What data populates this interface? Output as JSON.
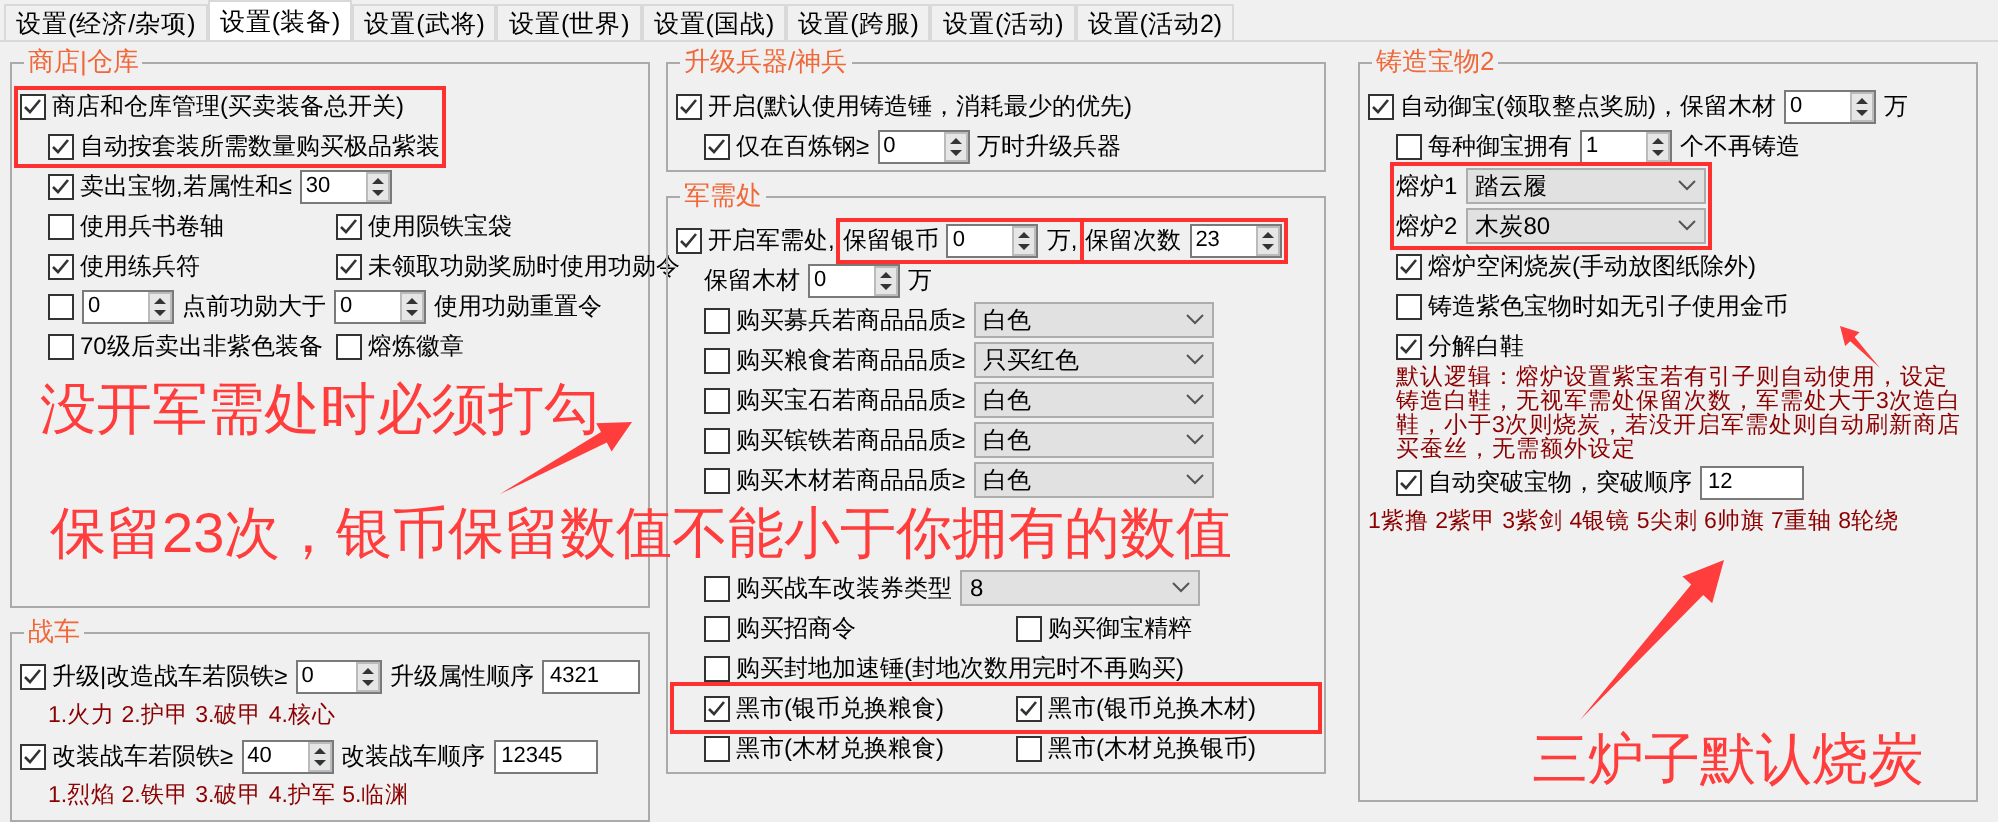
{
  "tabs": [
    {
      "label": "设置(经济/杂项)",
      "selected": false
    },
    {
      "label": "设置(装备)",
      "selected": true
    },
    {
      "label": "设置(武将)",
      "selected": false
    },
    {
      "label": "设置(世界)",
      "selected": false
    },
    {
      "label": "设置(国战)",
      "selected": false
    },
    {
      "label": "设置(跨服)",
      "selected": false
    },
    {
      "label": "设置(活动)",
      "selected": false
    },
    {
      "label": "设置(活动2)",
      "selected": false
    }
  ],
  "columns": [
    {
      "groups": [
        {
          "title": "商店|仓库",
          "rows": [
            {
              "indent": false,
              "items": [
                {
                  "kind": "check",
                  "label": "商店和仓库管理(买卖装备总开关)",
                  "checked": true
                }
              ]
            },
            {
              "indent": true,
              "items": [
                {
                  "kind": "check",
                  "label": "自动按套装所需数量购买极品紫装",
                  "checked": true
                }
              ]
            },
            {
              "indent": true,
              "items": [
                {
                  "kind": "check",
                  "label": "卖出宝物,若属性和≤",
                  "checked": true
                },
                {
                  "kind": "spin",
                  "value": "30"
                }
              ]
            },
            {
              "indent": true,
              "items": [
                {
                  "kind": "check",
                  "label": "使用兵书卷轴",
                  "checked": false
                },
                {
                  "kind": "check",
                  "label": "使用陨铁宝袋",
                  "checked": true
                }
              ]
            },
            {
              "indent": true,
              "items": [
                {
                  "kind": "check",
                  "label": "使用练兵符",
                  "checked": true
                },
                {
                  "kind": "check",
                  "label": "未领取功勋奖励时使用功勋令",
                  "checked": true
                }
              ]
            },
            {
              "indent": true,
              "items": [
                {
                  "kind": "check",
                  "checked": false
                },
                {
                  "kind": "spin",
                  "value": "0"
                },
                {
                  "kind": "label",
                  "text": "点前功勋大于"
                },
                {
                  "kind": "spin",
                  "value": "0"
                },
                {
                  "kind": "label",
                  "text": "使用功勋重置令"
                }
              ]
            },
            {
              "indent": true,
              "items": [
                {
                  "kind": "check",
                  "label": "70级后卖出非紫色装备",
                  "checked": false
                },
                {
                  "kind": "check",
                  "label": "熔炼徽章",
                  "checked": false
                }
              ]
            }
          ]
        },
        {
          "title": "战车",
          "rows": [
            {
              "indent": false,
              "items": [
                {
                  "kind": "check",
                  "label": "升级|改造战车若陨铁≥",
                  "checked": true
                },
                {
                  "kind": "spin",
                  "value": "0"
                },
                {
                  "kind": "label",
                  "text": "升级属性顺序"
                },
                {
                  "kind": "input",
                  "value": "4321"
                }
              ]
            },
            {
              "indent": true,
              "items": [
                {
                  "kind": "note",
                  "text": "1.火力 2.护甲 3.破甲 4.核心"
                }
              ]
            },
            {
              "indent": false,
              "items": [
                {
                  "kind": "check",
                  "label": "改装战车若陨铁≥",
                  "checked": true
                },
                {
                  "kind": "spin",
                  "value": "40"
                },
                {
                  "kind": "label",
                  "text": "改装战车顺序"
                },
                {
                  "kind": "input",
                  "value": "12345"
                }
              ]
            },
            {
              "indent": true,
              "items": [
                {
                  "kind": "note",
                  "text": "1.烈焰 2.铁甲 3.破甲 4.护军 5.临渊"
                }
              ]
            }
          ]
        }
      ]
    },
    {
      "groups": [
        {
          "title": "升级兵器/神兵",
          "rows": [
            {
              "indent": false,
              "items": [
                {
                  "kind": "check",
                  "label": "开启(默认使用铸造锤，消耗最少的优先)",
                  "checked": true
                }
              ]
            },
            {
              "indent": true,
              "items": [
                {
                  "kind": "check",
                  "label": "仅在百炼钢≥",
                  "checked": true
                },
                {
                  "kind": "spin",
                  "value": "0"
                },
                {
                  "kind": "label",
                  "text": "万时升级兵器"
                }
              ]
            }
          ]
        },
        {
          "title": "军需处",
          "rows": [
            {
              "indent": false,
              "items": [
                {
                  "kind": "check",
                  "label": "开启军需处,",
                  "checked": true
                },
                {
                  "kind": "label",
                  "text": "保留银币"
                },
                {
                  "kind": "spin",
                  "value": "0"
                },
                {
                  "kind": "label",
                  "text": "万,"
                },
                {
                  "kind": "label",
                  "text": "保留次数"
                },
                {
                  "kind": "spin",
                  "value": "23"
                }
              ]
            },
            {
              "indent": true,
              "items": [
                {
                  "kind": "label",
                  "text": "保留木材"
                },
                {
                  "kind": "spin",
                  "value": "0"
                },
                {
                  "kind": "label",
                  "text": "万"
                }
              ]
            },
            {
              "indent": true,
              "items": [
                {
                  "kind": "check",
                  "label": "购买募兵若商品品质≥",
                  "checked": false
                },
                {
                  "kind": "select",
                  "value": "白色"
                }
              ]
            },
            {
              "indent": true,
              "items": [
                {
                  "kind": "check",
                  "label": "购买粮食若商品品质≥",
                  "checked": false
                },
                {
                  "kind": "select",
                  "value": "只买红色"
                }
              ]
            },
            {
              "indent": true,
              "items": [
                {
                  "kind": "check",
                  "label": "购买宝石若商品品质≥",
                  "checked": false
                },
                {
                  "kind": "select",
                  "value": "白色"
                }
              ]
            },
            {
              "indent": true,
              "items": [
                {
                  "kind": "check",
                  "label": "购买镔铁若商品品质≥",
                  "checked": false
                },
                {
                  "kind": "select",
                  "value": "白色"
                }
              ]
            },
            {
              "indent": true,
              "items": [
                {
                  "kind": "check",
                  "label": "购买木材若商品品质≥",
                  "checked": false
                },
                {
                  "kind": "select",
                  "value": "白色"
                }
              ]
            },
            {
              "indent": true,
              "items": [
                {
                  "kind": "check",
                  "label": "购买战车改装券类型",
                  "checked": false
                },
                {
                  "kind": "select",
                  "value": "8"
                }
              ]
            },
            {
              "indent": true,
              "items": [
                {
                  "kind": "check",
                  "label": "购买招商令",
                  "checked": false
                },
                {
                  "kind": "check",
                  "label": "购买御宝精粹",
                  "checked": false
                }
              ]
            },
            {
              "indent": true,
              "items": [
                {
                  "kind": "check",
                  "label": "购买封地加速锤(封地次数用完时不再购买)",
                  "checked": false
                }
              ]
            },
            {
              "indent": true,
              "items": [
                {
                  "kind": "check",
                  "label": "黑市(银币兑换粮食)",
                  "checked": true
                },
                {
                  "kind": "check",
                  "label": "黑市(银币兑换木材)",
                  "checked": true
                }
              ]
            },
            {
              "indent": true,
              "items": [
                {
                  "kind": "check",
                  "label": "黑市(木材兑换粮食)",
                  "checked": false
                },
                {
                  "kind": "check",
                  "label": "黑市(木材兑换银币)",
                  "checked": false
                }
              ]
            }
          ]
        }
      ]
    },
    {
      "groups": [
        {
          "title": "铸造宝物2",
          "rows": [
            {
              "indent": false,
              "items": [
                {
                  "kind": "check",
                  "label": "自动御宝(领取整点奖励)，保留木材",
                  "checked": true
                },
                {
                  "kind": "spin",
                  "value": "0"
                },
                {
                  "kind": "label",
                  "text": "万"
                }
              ]
            },
            {
              "indent": true,
              "items": [
                {
                  "kind": "check",
                  "label": "每种御宝拥有",
                  "checked": false
                },
                {
                  "kind": "spin",
                  "value": "1"
                },
                {
                  "kind": "label",
                  "text": "个不再铸造"
                }
              ]
            },
            {
              "indent": true,
              "items": [
                {
                  "kind": "label",
                  "text": "熔炉1"
                },
                {
                  "kind": "select",
                  "value": "踏云履"
                }
              ]
            },
            {
              "indent": true,
              "items": [
                {
                  "kind": "label",
                  "text": "熔炉2"
                },
                {
                  "kind": "select",
                  "value": "木炭80"
                }
              ]
            },
            {
              "indent": true,
              "items": [
                {
                  "kind": "check",
                  "label": "熔炉空闲烧炭(手动放图纸除外)",
                  "checked": true
                }
              ]
            },
            {
              "indent": true,
              "items": [
                {
                  "kind": "check",
                  "label": "铸造紫色宝物时如无引子使用金币",
                  "checked": false
                }
              ]
            },
            {
              "indent": true,
              "items": [
                {
                  "kind": "check",
                  "label": "分解白鞋",
                  "checked": true
                }
              ]
            },
            {
              "indent": true,
              "items": [
                {
                  "kind": "note",
                  "text": "默认逻辑：熔炉设置紫宝若有引子则自动使用，设定铸造白鞋，无视军需处保留次数，军需处大于3次造白鞋，小于3次则烧炭，若没开启军需处则自动刷新商店买蚕丝，无需额外设定"
                }
              ]
            },
            {
              "indent": true,
              "items": [
                {
                  "kind": "check",
                  "label": "自动突破宝物，突破顺序",
                  "checked": true
                },
                {
                  "kind": "input",
                  "value": "12"
                }
              ]
            },
            {
              "indent": false,
              "items": [
                {
                  "kind": "note",
                  "text": "1紫撸 2紫甲 3紫剑 4银镜 5尖刺 6帅旗 7重轴 8轮绕"
                }
              ]
            }
          ]
        }
      ]
    }
  ],
  "annotations": [
    {
      "text": "没开军需处时必须打勾"
    },
    {
      "text": "保留23次，银币保留数值不能小于你拥有的数值"
    },
    {
      "text": "三炉子默认烧炭"
    }
  ]
}
